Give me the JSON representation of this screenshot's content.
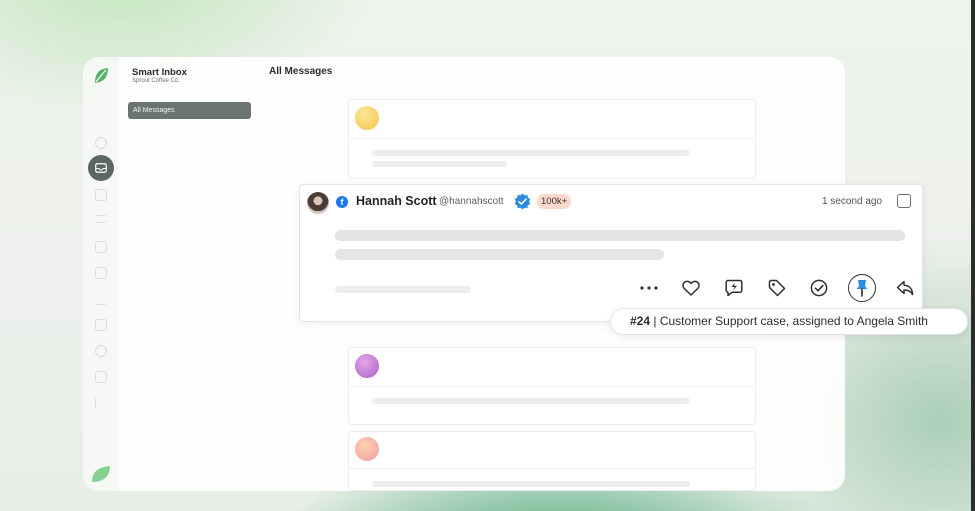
{
  "app": {
    "brand_title": "Smart Inbox",
    "brand_subtitle": "Sprout Coffee Co.",
    "nav_all_messages": "All Messages",
    "main_title": "All Messages"
  },
  "colors": {
    "brand_green": "#59b26a",
    "facebook_blue": "#1877f2",
    "verified_blue": "#2d8be0",
    "followers_badge_bg": "#fbd9cd"
  },
  "post": {
    "network_icon": "facebook-icon",
    "author_name": "Hannah Scott",
    "author_handle": "@hannahscott",
    "followers_badge": "100k+",
    "timestamp": "1 second ago",
    "actions": [
      {
        "name": "more-icon"
      },
      {
        "name": "like-icon"
      },
      {
        "name": "quick-reply-icon"
      },
      {
        "name": "tag-icon"
      },
      {
        "name": "complete-icon"
      },
      {
        "name": "pin-icon",
        "active": true
      },
      {
        "name": "reply-icon"
      }
    ]
  },
  "tooltip": {
    "case_number": "#24",
    "case_text": " | Customer Support case, assigned to Angela Smith"
  }
}
